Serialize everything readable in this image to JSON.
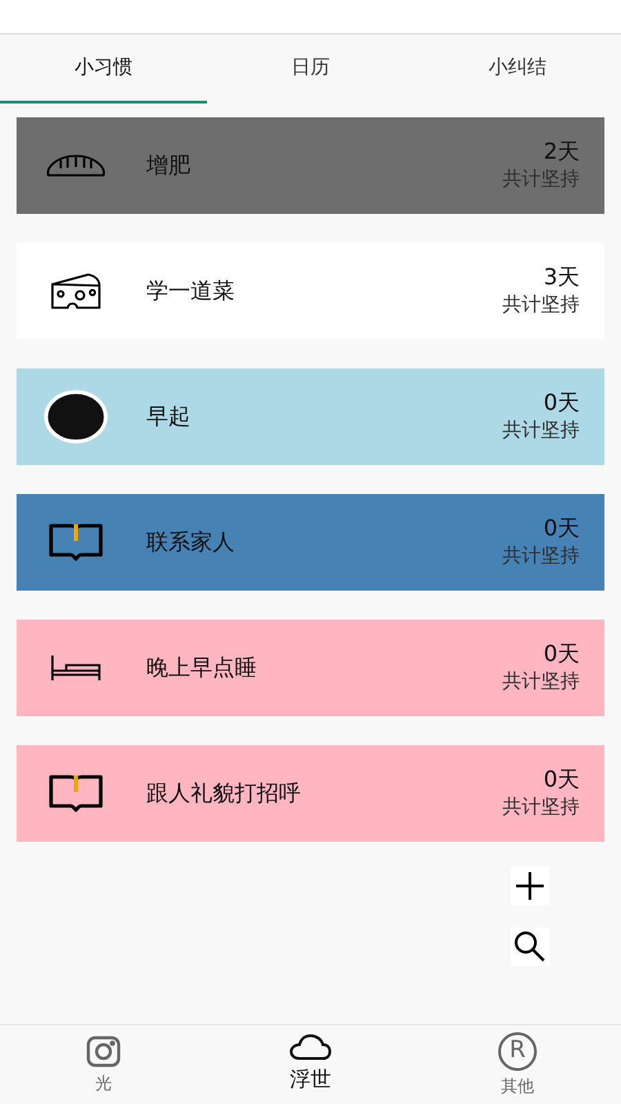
{
  "tabs": [
    {
      "label": "小习惯",
      "selected": true
    },
    {
      "label": "日历",
      "selected": false
    },
    {
      "label": "小纠结",
      "selected": false
    }
  ],
  "habits": [
    {
      "kind": "bread",
      "name": "增肥",
      "days": "2天",
      "caption": "共计坚持",
      "color": "#6e6e6e"
    },
    {
      "kind": "cheese",
      "name": "学一道菜",
      "days": "3天",
      "caption": "共计坚持",
      "color": "#ffffff"
    },
    {
      "kind": "ball",
      "name": "早起",
      "days": "0天",
      "caption": "共计坚持",
      "color": "#add8e6"
    },
    {
      "kind": "book",
      "name": "联系家人",
      "days": "0天",
      "caption": "共计坚持",
      "color": "#4682b4"
    },
    {
      "kind": "bed",
      "name": "晚上早点睡",
      "days": "0天",
      "caption": "共计坚持",
      "color": "#ffb6c1"
    },
    {
      "kind": "book",
      "name": "跟人礼貌打招呼",
      "days": "0天",
      "caption": "共计坚持",
      "color": "#ffb6c1"
    }
  ],
  "actions": [
    {
      "kind": "add"
    },
    {
      "kind": "search"
    }
  ],
  "nav": [
    {
      "kind": "camera",
      "label": "光",
      "selected": false
    },
    {
      "kind": "cloud",
      "label": "浮世",
      "selected": true
    },
    {
      "kind": "registered",
      "symbol": "R",
      "label": "其他",
      "selected": false
    }
  ]
}
